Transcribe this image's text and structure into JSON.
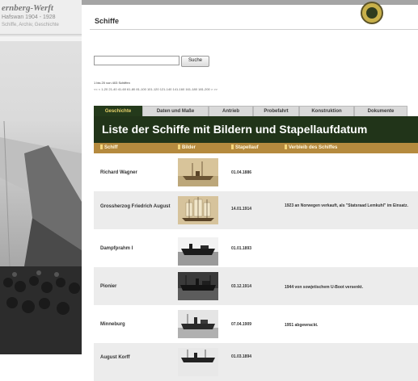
{
  "sidebar": {
    "brand_title": "ernberg-Werft",
    "brand_sub": "Hafswan 1904 - 1928",
    "brand_sub2": "Schiffe, Archiv, Geschichte"
  },
  "header": {
    "page_title": "Schiffe"
  },
  "search": {
    "value": "",
    "placeholder": "",
    "button_label": "Suche"
  },
  "results_info": "1 bis 20 von 403 Schiffen",
  "pager": "<< < 1-20 21-40 41-60 61-80 81-100 101-120 121-140 141-160 161-180 181-200 > >>",
  "tabs": [
    {
      "label": "Geschichte",
      "active": true
    },
    {
      "label": "Daten und Maße",
      "active": false
    },
    {
      "label": "Antrieb",
      "active": false
    },
    {
      "label": "Probefahrt",
      "active": false
    },
    {
      "label": "Konstruktion",
      "active": false
    },
    {
      "label": "Dokumente",
      "active": false
    }
  ],
  "list_title": "Liste der Schiffe mit Bildern und Stapellaufdatum",
  "columns": {
    "ship": "Schiff",
    "images": "Bilder",
    "launch": "Stapellauf",
    "fate": "Verbleib des Schiffes"
  },
  "ships": [
    {
      "name": "Richard Wagner",
      "date": "01.04.1886",
      "note": "",
      "thumb": "sepia-ship-icon"
    },
    {
      "name": "Grossherzog Friedrich August",
      "date": "14.01.1914",
      "note": "1923 an Norwegen verkauft, als \"Statsraad Lemkuhl\" im Einsatz.",
      "thumb": "sailing-ship-icon"
    },
    {
      "name": "Dampfprahm I",
      "date": "01.01.1893",
      "note": "",
      "thumb": "steamer-icon"
    },
    {
      "name": "Pionier",
      "date": "03.12.1914",
      "note": "1944 von sowjetischem U-Boot versenkt.",
      "thumb": "cargo-ship-icon"
    },
    {
      "name": "Minneburg",
      "date": "07.04.1909",
      "note": "1951 abgewrackt.",
      "thumb": "steamship-icon"
    },
    {
      "name": "August Korff",
      "date": "01.03.1894",
      "note": "",
      "thumb": "ship-icon"
    }
  ],
  "colors": {
    "banner": "#213419",
    "tab_active": "#243a1b",
    "column_header": "#b58a3e",
    "logo_gold": "#c8b04a"
  }
}
